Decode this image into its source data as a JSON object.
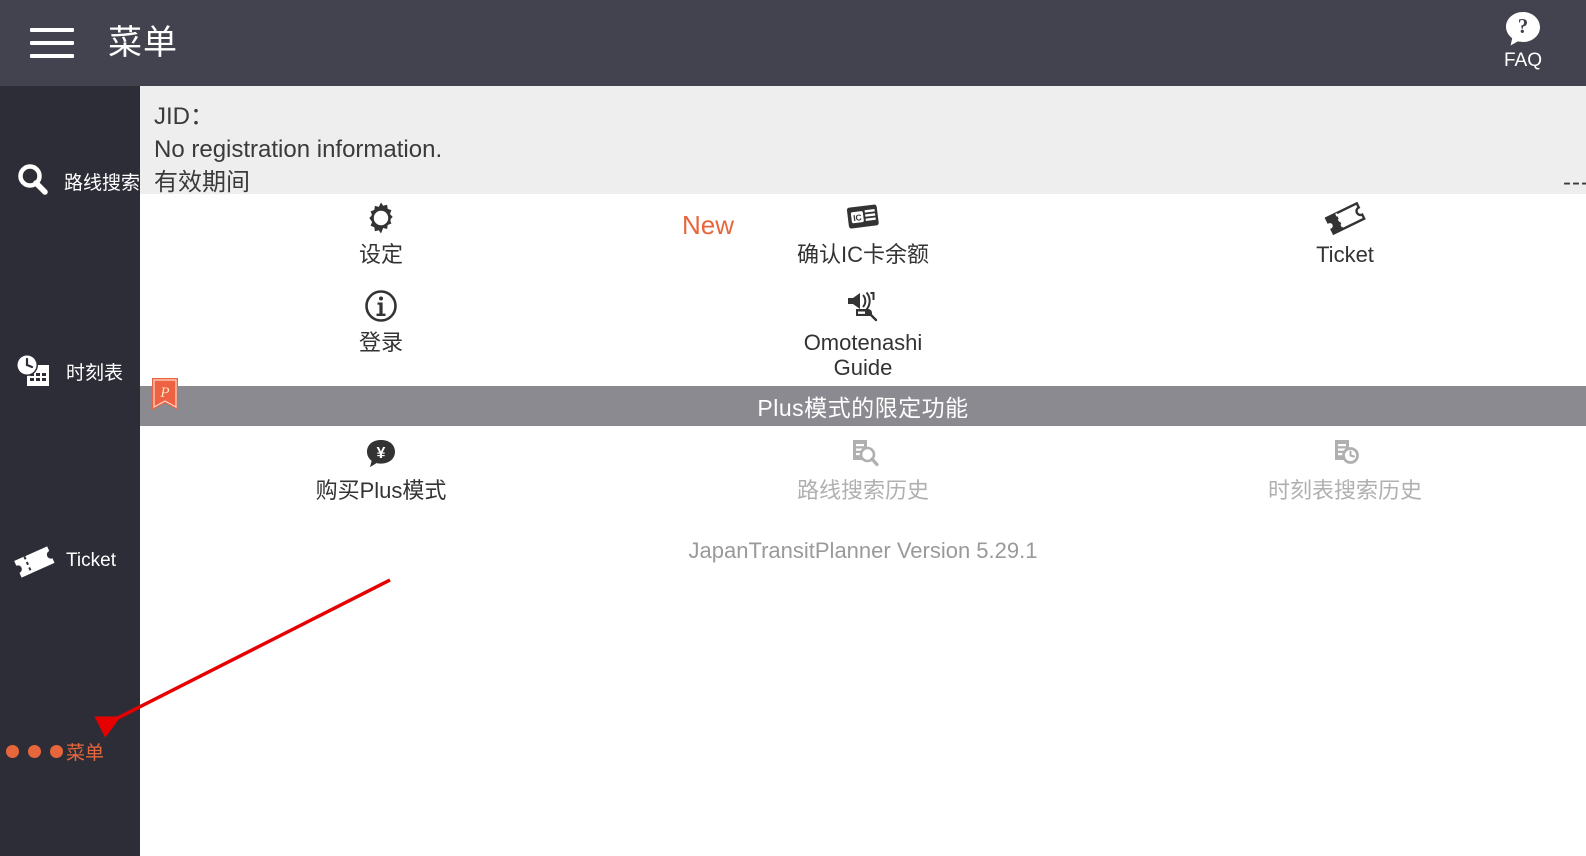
{
  "header": {
    "menu_icon": "hamburger-icon",
    "title": "菜单",
    "faq_label": "FAQ",
    "faq_icon": "question-bubble-icon"
  },
  "sidebar": {
    "items": [
      {
        "label": "路线搜索",
        "icon": "search-icon",
        "active": false
      },
      {
        "label": "时刻表",
        "icon": "timetable-clock-icon",
        "active": false
      },
      {
        "label": "Ticket",
        "icon": "ticket-icon",
        "active": false
      },
      {
        "label": "菜单",
        "icon": "more-dots-icon",
        "active": true
      }
    ]
  },
  "account": {
    "jid_label": "JID：",
    "registration": "No registration information.",
    "valid_period_label": "有效期间",
    "valid_period_value": "---"
  },
  "menu": {
    "rows": [
      [
        {
          "label": "设定",
          "icon": "gear-icon",
          "disabled": false,
          "badge": ""
        },
        {
          "label": "确认IC卡余额",
          "icon": "ic-card-icon",
          "disabled": false,
          "badge": "New"
        },
        {
          "label": "Ticket",
          "icon": "ticket-icon",
          "disabled": false,
          "badge": ""
        }
      ],
      [
        {
          "label": "登录",
          "icon": "info-circle-icon",
          "disabled": false,
          "badge": ""
        },
        {
          "label": "Omotenashi\nGuide",
          "icon": "audio-guide-icon",
          "disabled": false,
          "badge": ""
        },
        {
          "label": "",
          "icon": "",
          "disabled": false,
          "badge": ""
        }
      ]
    ],
    "plus_bar": {
      "text": "Plus模式的限定功能",
      "ribbon_letter": "P",
      "ribbon_color": "#ec6242",
      "bar_color": "#8a8a90"
    },
    "plus_rows": [
      [
        {
          "label": "购买Plus模式",
          "icon": "yen-bubble-icon",
          "disabled": false,
          "badge": ""
        },
        {
          "label": "路线搜索历史",
          "icon": "route-history-icon",
          "disabled": true,
          "badge": ""
        },
        {
          "label": "时刻表搜索历史",
          "icon": "timetable-history-icon",
          "disabled": true,
          "badge": ""
        }
      ]
    ],
    "version": "JapanTransitPlanner Version 5.29.1"
  },
  "annotation": {
    "arrow_color": "#e60000",
    "arrow_from": "390,580",
    "arrow_to": "98,728"
  },
  "colors": {
    "header_bg": "#434350",
    "sidebar_bg": "#2d2d38",
    "accent": "#e8663c",
    "panel_bg": "#eeeeee",
    "disabled_text": "#b0b0b0"
  }
}
